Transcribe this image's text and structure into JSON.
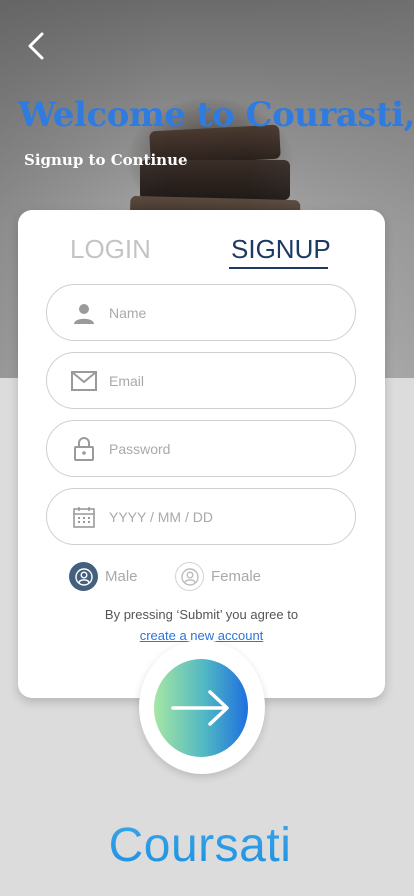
{
  "header": {
    "welcome": "Welcome to Courasti,",
    "subtitle": "Signup to Continue"
  },
  "tabs": [
    {
      "label": "LOGIN",
      "active": false
    },
    {
      "label": "SIGNUP",
      "active": true
    }
  ],
  "form": {
    "name": {
      "placeholder": "Name",
      "icon": "user-icon"
    },
    "email": {
      "placeholder": "Email",
      "icon": "mail-icon"
    },
    "password": {
      "placeholder": "Password",
      "icon": "lock-icon"
    },
    "date": {
      "placeholder": "YYYY / MM / DD",
      "icon": "calendar-icon"
    }
  },
  "gender": {
    "options": [
      {
        "label": "Male",
        "selected": true
      },
      {
        "label": "Female",
        "selected": false
      }
    ]
  },
  "agreement": {
    "text": "By pressing ‘Submit’ you agree to",
    "link": "create a new account"
  },
  "submit": {
    "icon": "arrow-right-icon"
  },
  "brand": {
    "name": "Coursati"
  },
  "colors": {
    "accent": "#2f7be0",
    "tab_active": "#1e3a63",
    "radio_selected": "#44607f",
    "link": "#2f74d6"
  }
}
